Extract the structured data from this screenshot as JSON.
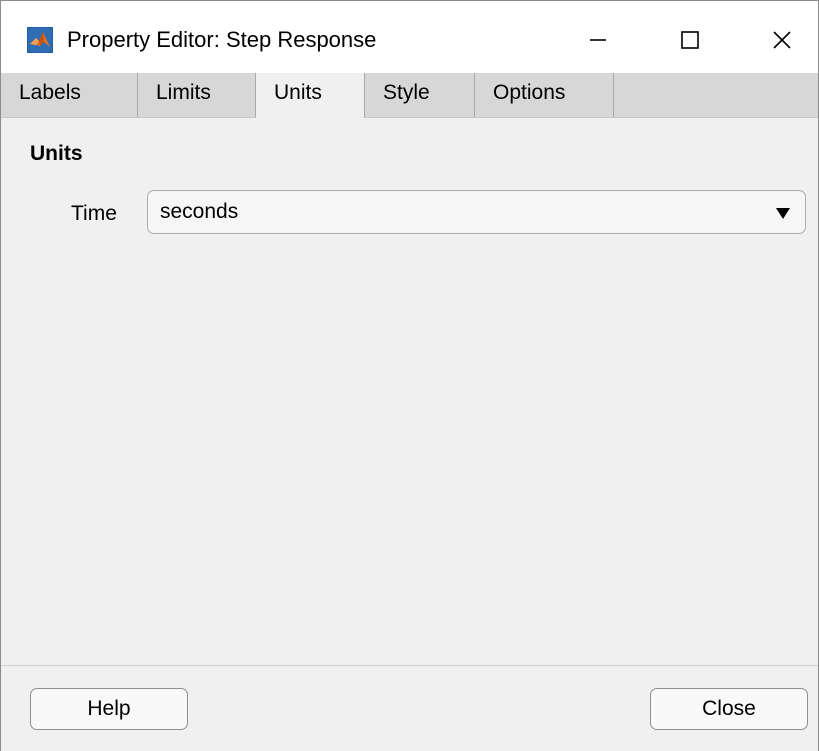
{
  "window": {
    "title": "Property Editor: Step Response",
    "controls": {
      "minimize_icon": "minimize-icon",
      "maximize_icon": "maximize-icon",
      "close_icon": "close-icon"
    }
  },
  "tabs": [
    {
      "label": "Labels",
      "active": false
    },
    {
      "label": "Limits",
      "active": false
    },
    {
      "label": "Units",
      "active": true
    },
    {
      "label": "Style",
      "active": false
    },
    {
      "label": "Options",
      "active": false
    }
  ],
  "units_panel": {
    "section_title": "Units",
    "time_label": "Time",
    "time_value": "seconds"
  },
  "footer": {
    "help_label": "Help",
    "close_label": "Close"
  },
  "colors": {
    "window_bg": "#f0f0f0",
    "tabstrip_bg": "#d7d7d7",
    "active_tab_bg": "#f0f0f0",
    "matlab_icon_orange": "#e0701e",
    "matlab_icon_blue": "#1f5fa8"
  }
}
